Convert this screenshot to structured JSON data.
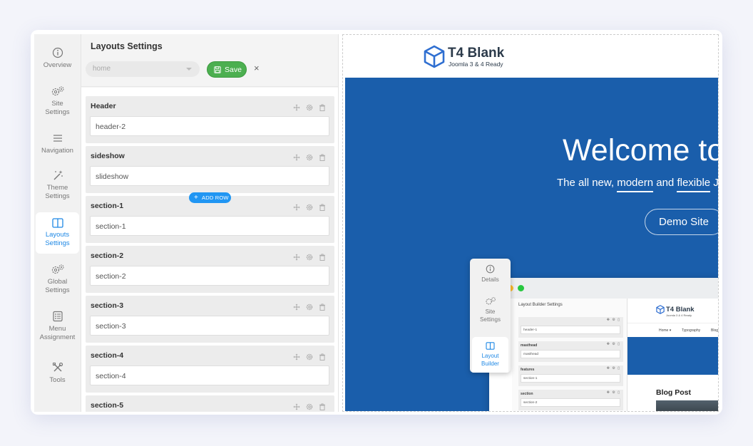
{
  "sidebar": {
    "items": [
      {
        "label": "Overview",
        "icon": "info-icon"
      },
      {
        "label": "Site\nSettings",
        "icon": "gears-icon"
      },
      {
        "label": "Navigation",
        "icon": "menu-icon"
      },
      {
        "label": "Theme\nSettings",
        "icon": "magic-wand-icon"
      },
      {
        "label": "Layouts\nSettings",
        "icon": "layout-icon",
        "active": true
      },
      {
        "label": "Global\nSettings",
        "icon": "gears-icon"
      },
      {
        "label": "Menu\nAssignment",
        "icon": "list-icon"
      },
      {
        "label": "Tools",
        "icon": "tools-icon"
      }
    ]
  },
  "panel": {
    "title": "Layouts Settings",
    "layout_select_value": "home",
    "save_label": "Save",
    "close_symbol": "×",
    "add_row_label": "ADD ROW"
  },
  "rows": [
    {
      "label": "Header",
      "value": "header-2"
    },
    {
      "label": "sideshow",
      "value": "slideshow"
    },
    {
      "label": "section-1",
      "value": "section-1"
    },
    {
      "label": "section-2",
      "value": "section-2"
    },
    {
      "label": "section-3",
      "value": "section-3"
    },
    {
      "label": "section-4",
      "value": "section-4"
    },
    {
      "label": "section-5",
      "value": ""
    }
  ],
  "preview": {
    "logo_name": "T4 Blank",
    "logo_sub": "Joomla 3 & 4 Ready",
    "hero_title": "Welcome to",
    "hero_sub_1": "The all new, ",
    "hero_sub_modern": "modern",
    "hero_sub_2": " and ",
    "hero_sub_flexible": "flexible",
    "hero_sub_3": " Jo",
    "demo_button": "Demo Site",
    "mockup": {
      "panel_title": "Layout Builder Settings",
      "rows": [
        {
          "label": "",
          "value": "header-1"
        },
        {
          "label": "masthead",
          "value": "masthead"
        },
        {
          "label": "features",
          "value": "section-1"
        },
        {
          "label": "section",
          "value": "section-2"
        }
      ],
      "logo_name": "T4 Blank",
      "logo_sub": "Joomla 3 & 4 Ready",
      "nav": [
        "Home ▾",
        "Typography",
        "Blog"
      ],
      "blog_title": "Blog Post",
      "rail": [
        {
          "label": "Details"
        },
        {
          "label": "Site\nSettings"
        },
        {
          "label": "Layout\nBuilder",
          "active": true
        }
      ],
      "dot_colors": [
        "#ff5f57",
        "#febc2e",
        "#28c840"
      ]
    }
  },
  "colors": {
    "accent": "#1e88e5",
    "save": "#4caf50",
    "hero": "#1a5eab"
  }
}
